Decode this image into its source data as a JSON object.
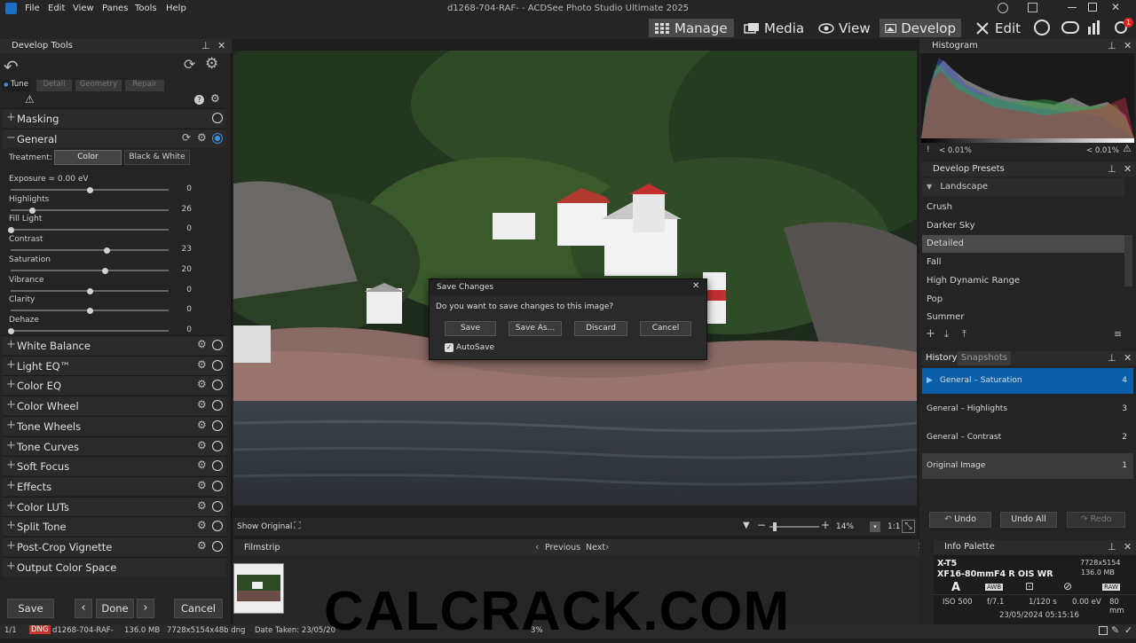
{
  "app": {
    "title": "d1268-704-RAF- - ACDSee Photo Studio Ultimate 2025",
    "menu": [
      "File",
      "Edit",
      "View",
      "Panes",
      "Tools",
      "Help"
    ],
    "modes": [
      {
        "label": "Manage",
        "icon": "grid-icon"
      },
      {
        "label": "Media",
        "icon": "media-icon"
      },
      {
        "label": "View",
        "icon": "eye-icon"
      },
      {
        "label": "Develop",
        "icon": "develop-icon"
      },
      {
        "label": "Edit",
        "icon": "edit-tools-icon"
      }
    ],
    "active_mode": "Develop",
    "accent": "#0a5fa8",
    "badge_count": "1"
  },
  "develop_tools": {
    "title": "Develop Tools",
    "tabs": [
      "Tune",
      "Detail",
      "Geometry",
      "Repair"
    ],
    "masking_label": "Masking",
    "general_label": "General",
    "treatment_label": "Treatment:",
    "treatment_color": "Color",
    "treatment_bw": "Black & White",
    "sliders": [
      {
        "label": "Exposure = 0.00 eV",
        "value": "0",
        "pos": 0.5
      },
      {
        "label": "Highlights",
        "value": "26",
        "pos": 0.14
      },
      {
        "label": "Fill Light",
        "value": "0",
        "pos": 0.0
      },
      {
        "label": "Contrast",
        "value": "23",
        "pos": 0.61
      },
      {
        "label": "Saturation",
        "value": "20",
        "pos": 0.6
      },
      {
        "label": "Vibrance",
        "value": "0",
        "pos": 0.5
      },
      {
        "label": "Clarity",
        "value": "0",
        "pos": 0.5
      },
      {
        "label": "Dehaze",
        "value": "0",
        "pos": 0.0
      }
    ],
    "groups": [
      "White Balance",
      "Light EQ™",
      "Color EQ",
      "Color Wheel",
      "Tone Wheels",
      "Tone Curves",
      "Soft Focus",
      "Effects",
      "Color LUTs",
      "Split Tone",
      "Post-Crop Vignette",
      "Output Color Space"
    ],
    "save_label": "Save",
    "done_label": "Done",
    "cancel_label": "Cancel"
  },
  "dialog": {
    "title": "Save Changes",
    "message": "Do you want to save changes to this image?",
    "buttons": [
      "Save",
      "Save As...",
      "Discard",
      "Cancel"
    ],
    "autosave_label": "AutoSave",
    "autosave_checked": true
  },
  "viewer": {
    "show_original": "Show Original",
    "zoom": "14%",
    "ratio": "1:1"
  },
  "filmstrip": {
    "title": "Filmstrip",
    "previous": "Previous",
    "next": "Next"
  },
  "histogram": {
    "title": "Histogram",
    "left_clip": "< 0.01%",
    "right_clip": "< 0.01%"
  },
  "presets": {
    "title": "Develop Presets",
    "category": "Landscape",
    "items": [
      "Crush",
      "Darker Sky",
      "Detailed",
      "Fall",
      "High Dynamic Range",
      "Pop",
      "Summer"
    ],
    "selected": "Detailed"
  },
  "history": {
    "tab_history": "History",
    "tab_snapshots": "Snapshots",
    "items": [
      {
        "label": "General – Saturation",
        "num": "4"
      },
      {
        "label": "General – Highlights",
        "num": "3"
      },
      {
        "label": "General – Contrast",
        "num": "2"
      },
      {
        "label": "Original Image",
        "num": "1"
      }
    ],
    "undo": "Undo",
    "undo_all": "Undo All",
    "redo": "Redo"
  },
  "info": {
    "title": "Info Palette",
    "camera": "X-T5",
    "lens": "XF16-80mmF4 R OIS WR",
    "dimensions": "7728x5154",
    "size": "136.0 MB",
    "iso": "ISO 500",
    "aperture": "f/7.1",
    "shutter": "1/120 s",
    "ev": "0.00 eV",
    "focal": "80 mm",
    "date": "23/05/2024 05:15:16",
    "badges": [
      "A",
      "AWB",
      "RAW"
    ]
  },
  "status": {
    "index": "1/1",
    "format": "DNG",
    "filename": "d1268-704-RAF-",
    "filesize": "136.0 MB",
    "dims": "7728x5154x48b dng",
    "date": "Date Taken: 23/05/20",
    "zoom": "3%"
  },
  "watermark": "CALCRACK.COM"
}
